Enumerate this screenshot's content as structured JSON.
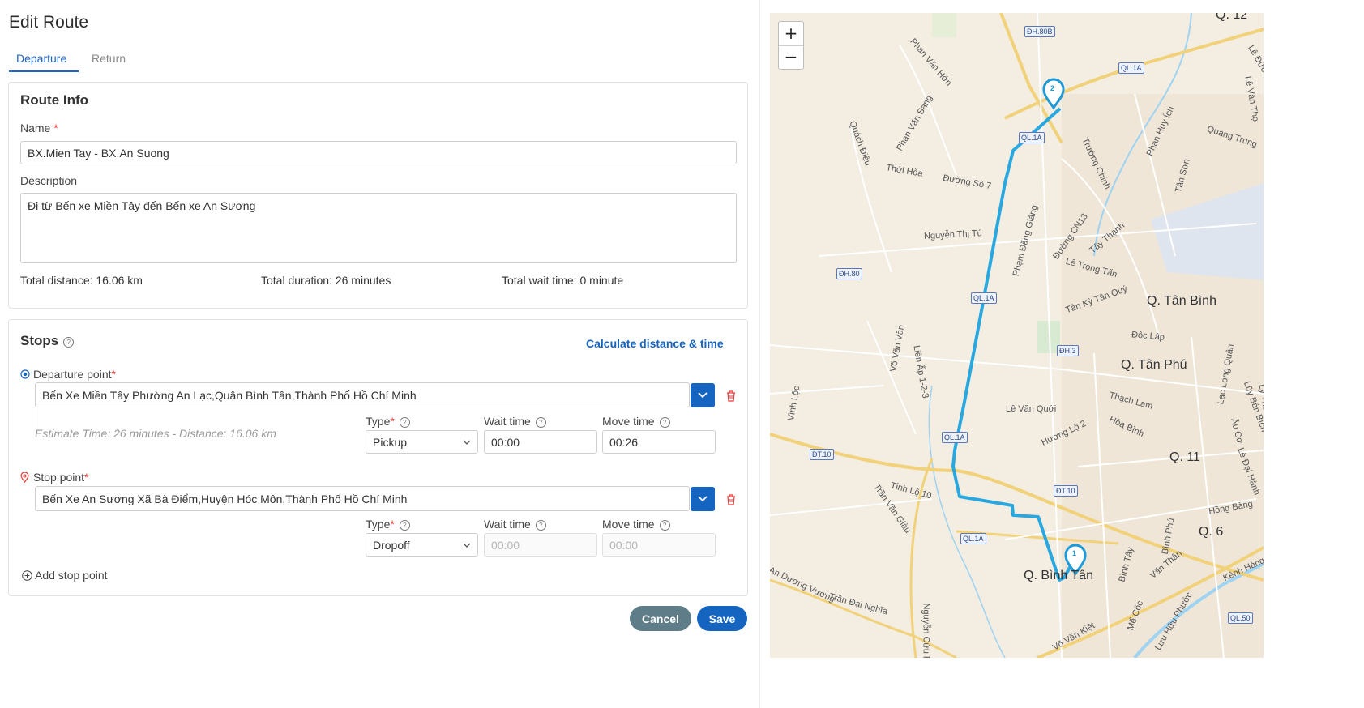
{
  "page": {
    "title": "Edit Route"
  },
  "tabs": [
    {
      "label": "Departure",
      "active": true
    },
    {
      "label": "Return",
      "active": false
    }
  ],
  "route_info": {
    "title": "Route Info",
    "name_label": "Name",
    "name_value": "BX.Mien Tay - BX.An Suong",
    "description_label": "Description",
    "description_value": "Đi từ Bến xe Miền Tây đến Bến xe An Sương",
    "total_distance": "Total distance: 16.06 km",
    "total_duration": "Total duration: 26 minutes",
    "total_wait": "Total wait time: 0 minute"
  },
  "stops": {
    "title": "Stops",
    "calculate_label": "Calculate distance & time",
    "departure": {
      "label": "Departure point",
      "value": "Bến Xe Miền Tây Phường An Lạc,Quận Bình Tân,Thành Phố Hồ Chí Minh",
      "estimate": "Estimate Time: 26 minutes - Distance: 16.06 km",
      "type_label": "Type",
      "type_value": "Pickup",
      "wait_label": "Wait time",
      "wait_value": "00:00",
      "move_label": "Move time",
      "move_value": "00:26"
    },
    "stop": {
      "label": "Stop point",
      "value": "Bến Xe An Sương Xã Bà Điểm,Huyện Hóc Môn,Thành Phố Hồ Chí Minh",
      "type_label": "Type",
      "type_value": "Dropoff",
      "wait_label": "Wait time",
      "wait_placeholder": "00:00",
      "move_label": "Move time",
      "move_placeholder": "00:00"
    },
    "add_label": "Add stop point"
  },
  "actions": {
    "cancel": "Cancel",
    "save": "Save"
  },
  "map": {
    "zoom_in": "+",
    "zoom_out": "−",
    "markers": {
      "start": "1",
      "end": "2"
    },
    "route_color": "#29a8e0",
    "districts": [
      "Q. 12",
      "Q. Tân Bình",
      "Q. Tân Phú",
      "Q. 11",
      "Q. 6",
      "Q. Bình Tân"
    ],
    "road_labels": [
      "Phan Văn Hớn",
      "Phan Văn Sáng",
      "Quách Điêu",
      "Thới Hòa",
      "Đường Số 7",
      "Trường Chinh",
      "Phan Huy Ích",
      "Quang Trung",
      "Tân Sơn",
      "Lê Văn Thọ",
      "Lê Đức Thọ",
      "Nguyễn Thị Tú",
      "Phạm Đăng Giảng",
      "Đường CN13",
      "Tây Thạnh",
      "Lê Trọng Tấn",
      "Tân Kỳ Tân Quý",
      "Độc Lập",
      "Võ Văn Vân",
      "Liên Ấp 1-2-3",
      "Vĩnh Lộc",
      "Lê Văn Quới",
      "Thạch Lam",
      "Hòa Bình",
      "Hương Lộ 2",
      "Lũy Bán Bích",
      "Âu Cơ",
      "Lạc Long Quân",
      "Tỉnh Lộ 10",
      "Trần Văn Giàu",
      "Trần Đại Nghĩa",
      "An Dương Vương",
      "Võ Văn Kiệt",
      "Kênh Hàng Bàng",
      "Bình Tây",
      "Nguyễn Cửu Phú",
      "Bình Phú",
      "Hồng Bàng",
      "Lê Đại Hành",
      "Lý Thường Kiệt",
      "Văn Thân",
      "Mể Cốc",
      "Lưu Hữu Phước"
    ],
    "shields": [
      "ĐH.80B",
      "QL.1A",
      "QL.1A",
      "ĐH.80",
      "QL.1A",
      "ĐH.3",
      "QL.1A",
      "ĐT.10",
      "ĐT.10",
      "QL.1A",
      "QL.50"
    ]
  }
}
